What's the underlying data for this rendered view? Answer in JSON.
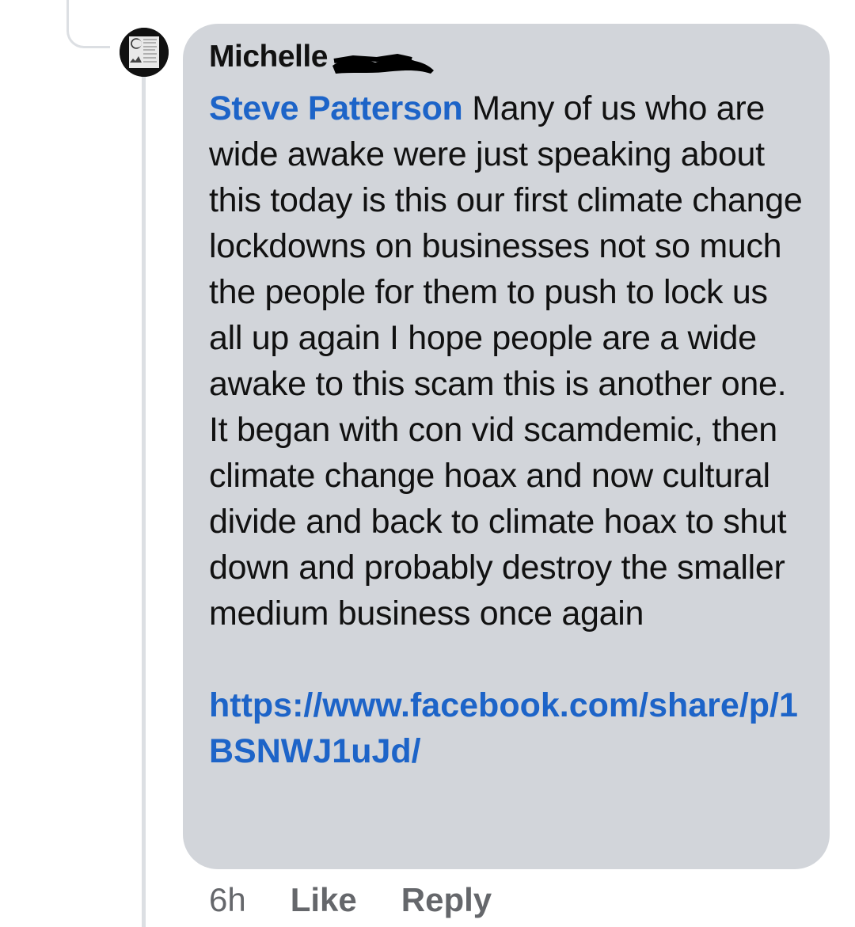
{
  "comment": {
    "author": "Michelle",
    "mention": "Steve Patterson",
    "text": "Many of  us who are wide awake were just speaking about this today is this our first climate change lockdowns on businesses not so much the people for them to push to lock us all up again I hope people are a wide awake to this scam this is another one. It began with con vid scamdemic, then climate change hoax and now cultural divide and back to climate hoax to shut down and probably destroy the smaller medium business once again",
    "link": "https://www.facebook.com/share/p/1BSNWJ1uJd/"
  },
  "actions": {
    "time": "6h",
    "like": "Like",
    "reply": "Reply"
  },
  "colors": {
    "bubble": "#d2d5da",
    "link": "#1d64c8",
    "meta": "#65676b"
  },
  "icons": {
    "avatar": "profile-avatar"
  }
}
